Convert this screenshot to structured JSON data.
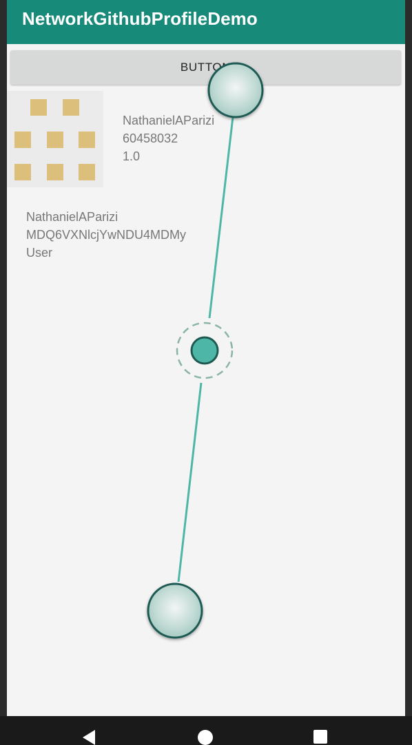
{
  "app_bar": {
    "title": "NetworkGithubProfileDemo"
  },
  "action_button": {
    "label": "BUTTON"
  },
  "profile": {
    "login": "NathanielAParizi",
    "id": "60458032",
    "score": "1.0"
  },
  "details": {
    "login": "NathanielAParizi",
    "node_id": "MDQ6VXNlcjYwNDU4MDMy",
    "type": "User"
  },
  "icons": {
    "avatar": "identicon",
    "nav_back": "back-triangle-icon",
    "nav_home": "home-circle-icon",
    "nav_recent": "recent-square-icon"
  },
  "colors": {
    "app_bar": "#178a7a",
    "identicon": "#dbbf7a",
    "gesture_line": "#4db6a6"
  }
}
